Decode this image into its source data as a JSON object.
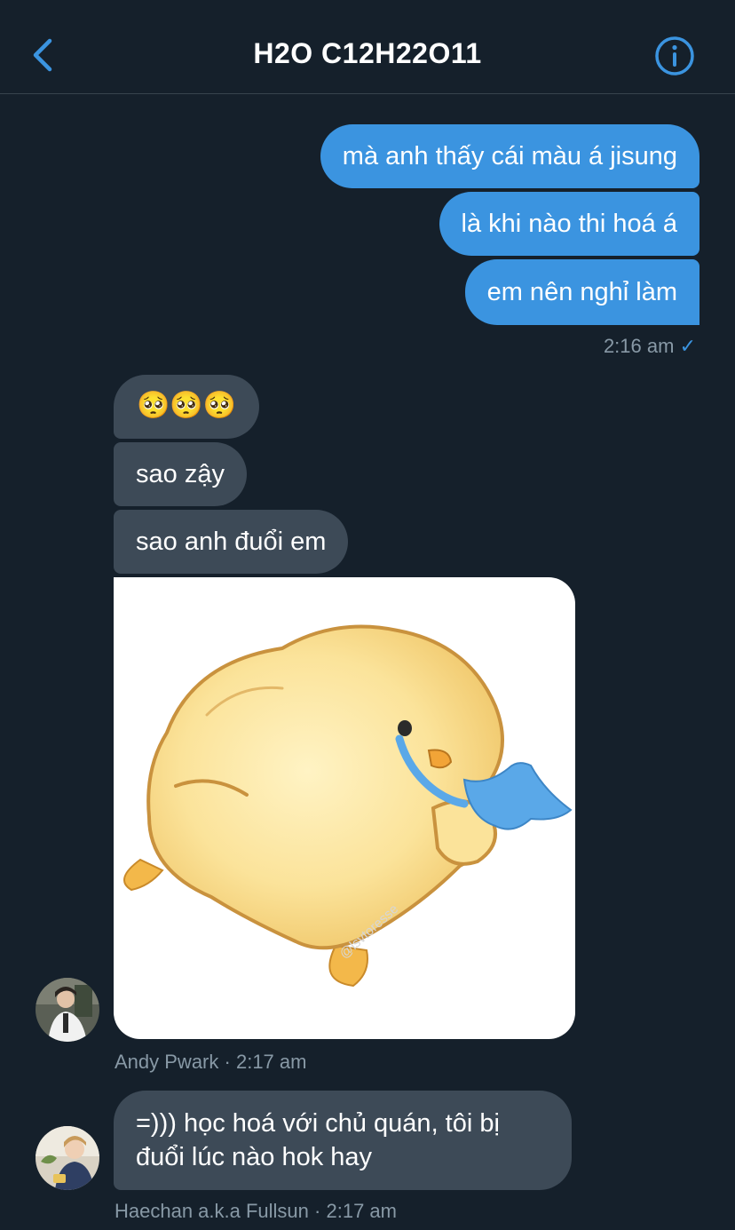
{
  "header": {
    "title": "H2O C12H22O11"
  },
  "messages_out": [
    {
      "text": "mà anh thấy cái màu á jisung"
    },
    {
      "text": "là khi nào thi hoá á"
    },
    {
      "text": "em nên nghỉ làm"
    }
  ],
  "out_meta": {
    "time": "2:16 am",
    "check": "✓"
  },
  "messages_in_1": [
    {
      "text": "🥺🥺🥺"
    },
    {
      "text": "sao zậy"
    },
    {
      "text": "sao anh đuổi em"
    }
  ],
  "sticker": {
    "watermark": "@lsvtoresse"
  },
  "in_meta_1": {
    "sender": "Andy Pwark",
    "sep": "·",
    "time": "2:17 am"
  },
  "messages_in_2": [
    {
      "line1": "=))) học hoá với chủ quán, tôi bị",
      "line2": "đuổi lúc nào hok hay"
    }
  ],
  "in_meta_2": {
    "sender": "Haechan a.k.a Fullsun",
    "sep": "·",
    "time": "2:17 am"
  },
  "colors": {
    "background": "#15202b",
    "outgoing_bubble": "#3b94e0",
    "incoming_bubble": "#3d4a57",
    "accent": "#3b94e0",
    "meta_text": "#8899a6"
  }
}
